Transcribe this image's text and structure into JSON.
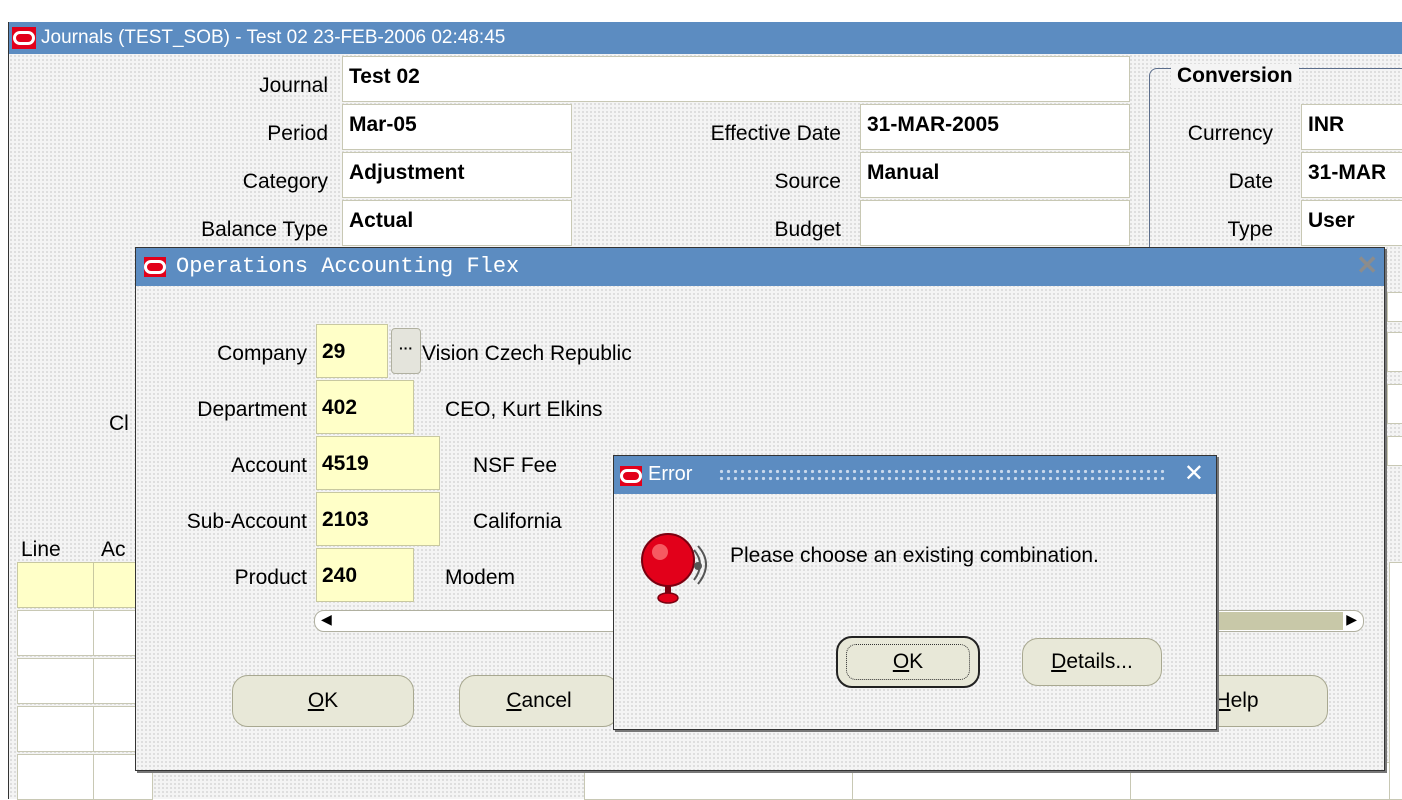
{
  "journal_window": {
    "title": "Journals (TEST_SOB) - Test 02 23-FEB-2006 02:48:45",
    "journal_label": "Journal",
    "journal_value": "Test 02",
    "period_label": "Period",
    "period_value": "Mar-05",
    "effective_date_label": "Effective Date",
    "effective_date_value": "31-MAR-2005",
    "category_label": "Category",
    "category_value": "Adjustment",
    "source_label": "Source",
    "source_value": "Manual",
    "balance_type_label": "Balance Type",
    "balance_type_value": "Actual",
    "budget_label": "Budget",
    "budget_value": "",
    "partial_label_cl": "Cl",
    "conversion": {
      "heading": "Conversion",
      "currency_label": "Currency",
      "currency_value": "INR",
      "date_label": "Date",
      "date_value": "31-MAR",
      "type_label": "Type",
      "type_value": "User"
    },
    "lines_headers": [
      "Line",
      "Ac"
    ],
    "help_button": "Help",
    "help_mnemonic": "H",
    "help_rest": "elp"
  },
  "flex_dialog": {
    "title": "Operations Accounting Flex",
    "segments": [
      {
        "label": "Company",
        "value": "29",
        "description": "Vision Czech Republic"
      },
      {
        "label": "Department",
        "value": "402",
        "description": "CEO, Kurt Elkins"
      },
      {
        "label": "Account",
        "value": "4519",
        "description": "NSF Fee"
      },
      {
        "label": "Sub-Account",
        "value": "2103",
        "description": "California"
      },
      {
        "label": "Product",
        "value": "240",
        "description": "Modem"
      }
    ],
    "lov_button": "···",
    "ok_mnemonic": "O",
    "ok_rest": "K",
    "cancel_mnemonic": "C",
    "cancel_rest": "ancel"
  },
  "error_dialog": {
    "title": "Error",
    "message": "Please choose an existing combination.",
    "ok_mnemonic": "O",
    "ok_rest": "K",
    "details_mnemonic": "D",
    "details_rest": "etails..."
  },
  "colors": {
    "titlebar": "#5c8cc1",
    "oracle_red": "#e2001a",
    "required_field": "#ffffc8"
  }
}
